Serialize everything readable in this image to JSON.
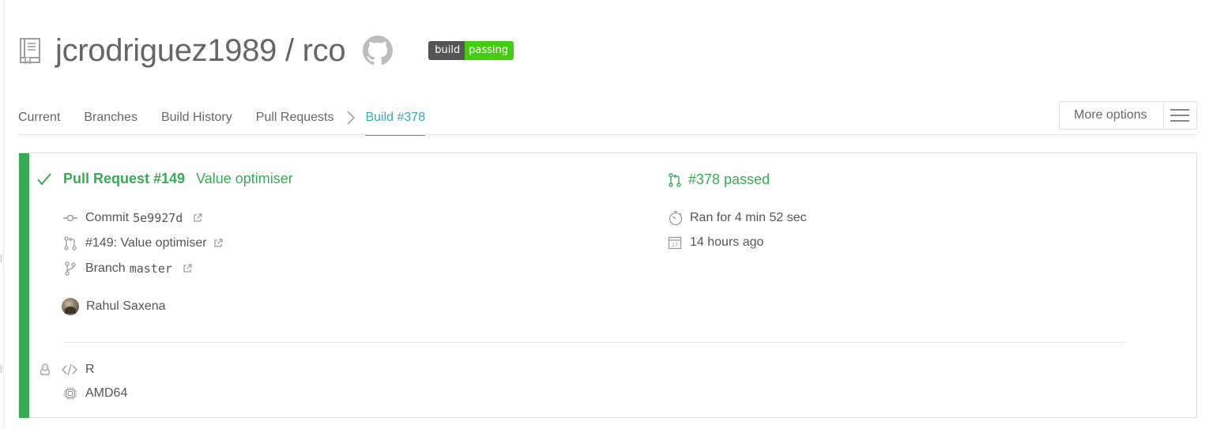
{
  "repo": {
    "owner": "jcrodriguez1989",
    "separator": "/",
    "name": "rco",
    "repo_icon": "repo-book-icon",
    "github_icon": "github-octocat-icon"
  },
  "badge": {
    "left": "build",
    "right": "passing",
    "left_color": "#555555",
    "right_color": "#44cc11"
  },
  "tabs": [
    {
      "label": "Current"
    },
    {
      "label": "Branches"
    },
    {
      "label": "Build History"
    },
    {
      "label": "Pull Requests"
    },
    {
      "label": "Build #378",
      "active": true
    }
  ],
  "more_options": {
    "label": "More options",
    "icon": "hamburger-menu-icon"
  },
  "build": {
    "status_color": "#39aa56",
    "accent_color": "#39aaaa",
    "title": "Pull Request #149",
    "subtitle": "Value optimiser",
    "status": "#378 passed",
    "commit_label": "Commit",
    "commit_sha": "5e9927d",
    "pr_label": "#149: Value optimiser",
    "branch_label": "Branch",
    "branch_name": "master",
    "author": "Rahul Saxena",
    "duration": "Ran for 4 min 52 sec",
    "finished": "14 hours ago",
    "language": "R",
    "arch": "AMD64"
  }
}
